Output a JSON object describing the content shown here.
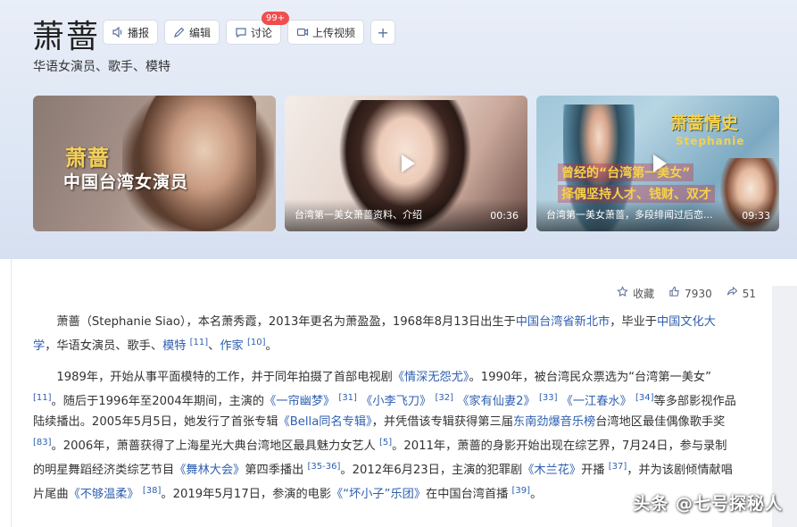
{
  "entry": {
    "title": "萧蔷",
    "subtitle": "华语女演员、歌手、模特"
  },
  "actions": {
    "broadcast": "播报",
    "edit": "编辑",
    "discuss": "讨论",
    "discuss_badge": "99+",
    "upload_video": "上传视频",
    "add": "+"
  },
  "videos": [
    {
      "overlay_name": "萧蔷",
      "overlay_subtitle": "中国台湾女演员",
      "caption": "",
      "duration": ""
    },
    {
      "caption": "台湾第一美女萧蔷资料、介绍",
      "duration": "00:36"
    },
    {
      "overlay_title": "萧蔷情史",
      "overlay_en": "Stephanie",
      "overlay_line1": "曾经的“台湾第一美女”",
      "overlay_line2": "择偶坚持人才、钱财、双才",
      "caption": "台湾第一美女萧蔷，多段绯闻过后恋...",
      "duration": "09:33"
    }
  ],
  "toolbar": {
    "collect": "收藏",
    "likes": "7930",
    "shares": "51"
  },
  "paragraph1": {
    "t1": "萧蔷（Stephanie Siao），本名萧秀霞，2013年更名为萧盈盈，1968年8月13日出生于",
    "l1": "中国台湾省新北市",
    "t2": "，毕业于",
    "l2": "中国文化大学",
    "t3": "，华语女演员、歌手、",
    "l3": "模特",
    "s1": "[11]",
    "t4": "、",
    "l4": "作家",
    "s2": "[10]",
    "t5": "。"
  },
  "paragraph2": {
    "t1": "1989年，开始从事平面模特的工作，并于同年拍摄了首部电视剧",
    "l1": "《情深无怨尤》",
    "t2": "。1990年，被台湾民众票选为“台湾第一美女”",
    "s1": "[11]",
    "t3": "。随后于1996年至2004年期间，主演的",
    "l2": "《一帘幽梦》",
    "s2": "[31]",
    "l3": "《小李飞刀》",
    "s3": "[32]",
    "l4": "《家有仙妻2》",
    "s4": "[33]",
    "l5": "《一江春水》",
    "s5": "[34]",
    "t4": "等多部影视作品陆续播出。2005年5月5日，她发行了首张专辑",
    "l6": "《Bella同名专辑》",
    "t5": "，并凭借该专辑获得第三届",
    "l7": "东南劲爆音乐榜",
    "t6": "台湾地区最佳偶像歌手奖",
    "s6": "[83]",
    "t7": "。2006年，萧蔷获得了上海星光大典台湾地区最具魅力女艺人",
    "s7": "[5]",
    "t8": "。2011年，萧蔷的身影开始出现在综艺界，7月24日，参与录制的明星舞蹈经济类综艺节目",
    "l8": "《舞林大会》",
    "t9": "第四季播出",
    "s8": "[35-36]",
    "t10": "。2012年6月23日，主演的犯罪剧",
    "l9": "《木兰花》",
    "t11": "开播",
    "s9": "[37]",
    "t12": "，并为该剧倾情献唱片尾曲",
    "l10": "《不够温柔》",
    "s10": "[38]",
    "t13": "。2019年5月17日，参演的电影",
    "l11": "《“坏小子”乐团》",
    "t14": "在中国台湾首播",
    "s11": "[39]",
    "t15": "。"
  },
  "watermark": "头条 @七号探秘人"
}
